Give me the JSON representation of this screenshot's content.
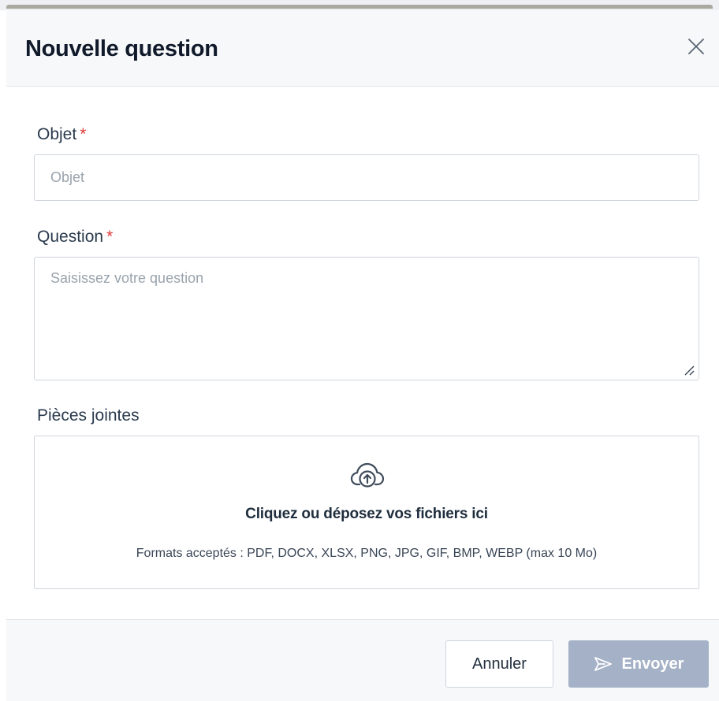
{
  "dialog": {
    "title": "Nouvelle question"
  },
  "form": {
    "subject": {
      "label": "Objet",
      "required_mark": "*",
      "value": "",
      "placeholder": "Objet"
    },
    "question": {
      "label": "Question",
      "required_mark": "*",
      "value": "",
      "placeholder": "Saisissez votre question"
    },
    "attachments": {
      "label": "Pièces jointes",
      "dropzone_title": "Cliquez ou déposez vos fichiers ici",
      "dropzone_hint": "Formats acceptés : PDF, DOCX, XLSX, PNG, JPG, GIF, BMP, WEBP (max 10 Mo)",
      "icon": "cloud-upload-icon"
    }
  },
  "footer": {
    "cancel_label": "Annuler",
    "send_label": "Envoyer",
    "send_icon": "send-icon"
  },
  "colors": {
    "required": "#e03a3a",
    "send_button_disabled": "#a4b1c6",
    "border": "#cfd5dd"
  }
}
